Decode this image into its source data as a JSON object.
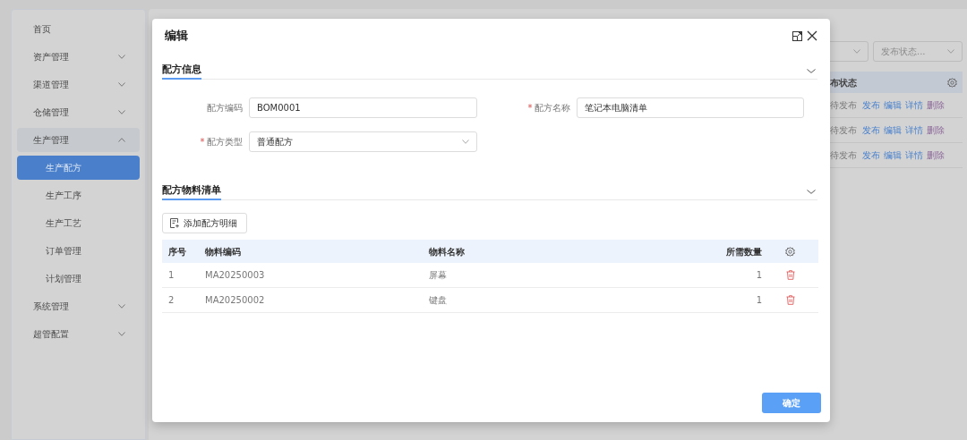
{
  "sidebar": {
    "items": [
      {
        "label": "首页",
        "kind": "link",
        "selected": false
      },
      {
        "label": "资产管理",
        "kind": "group",
        "selected": false,
        "expanded": false
      },
      {
        "label": "渠道管理",
        "kind": "group",
        "selected": false,
        "expanded": false
      },
      {
        "label": "仓储管理",
        "kind": "group",
        "selected": false,
        "expanded": false
      },
      {
        "label": "生产管理",
        "kind": "group",
        "selected": false,
        "expanded": true,
        "children": [
          {
            "label": "生产配方",
            "selected": true
          },
          {
            "label": "生产工序",
            "selected": false
          },
          {
            "label": "生产工艺",
            "selected": false
          },
          {
            "label": "订单管理",
            "selected": false
          },
          {
            "label": "计划管理",
            "selected": false
          }
        ]
      },
      {
        "label": "系统管理",
        "kind": "group",
        "selected": false,
        "expanded": false
      },
      {
        "label": "超管配置",
        "kind": "group",
        "selected": false,
        "expanded": false
      }
    ]
  },
  "page": {
    "filters": [
      {
        "kind": "select"
      },
      {
        "kind": "select",
        "placeholder": "发布状态..."
      }
    ],
    "table": {
      "columns": [
        "布状态"
      ],
      "rows": [
        {
          "status": "待发布",
          "actions": [
            {
              "label": "发布",
              "kind": "link"
            },
            {
              "label": "编辑",
              "kind": "link"
            },
            {
              "label": "详情",
              "kind": "link"
            },
            {
              "label": "删除",
              "kind": "danger"
            }
          ]
        },
        {
          "status": "待发布",
          "actions": [
            {
              "label": "发布",
              "kind": "link"
            },
            {
              "label": "编辑",
              "kind": "link"
            },
            {
              "label": "详情",
              "kind": "link"
            },
            {
              "label": "删除",
              "kind": "danger"
            }
          ]
        },
        {
          "status": "待发布",
          "actions": [
            {
              "label": "发布",
              "kind": "link"
            },
            {
              "label": "编辑",
              "kind": "link"
            },
            {
              "label": "详情",
              "kind": "link"
            },
            {
              "label": "删除",
              "kind": "danger"
            }
          ]
        }
      ]
    }
  },
  "dialog": {
    "title": "编辑",
    "sections": [
      {
        "title": "配方信息",
        "expanded": true,
        "fields": [
          {
            "label": "配方编码",
            "kind": "input",
            "value": "BOM0001"
          },
          {
            "label": "配方名称",
            "required_mark": "*",
            "kind": "input",
            "value": "笔记本电脑清单"
          },
          {
            "label": "配方类型",
            "required_mark": "*",
            "kind": "select",
            "value": "普通配方"
          }
        ]
      },
      {
        "title": "配方物料清单",
        "expanded": true,
        "add_button": "添加配方明细",
        "table": {
          "columns": [
            "序号",
            "物料编码",
            "物料名称",
            "所需数量"
          ],
          "rows": [
            {
              "no": "1",
              "code": "MA20250003",
              "name": "屏幕",
              "qty": "1"
            },
            {
              "no": "2",
              "code": "MA20250002",
              "name": "键盘",
              "qty": "1"
            }
          ]
        }
      }
    ],
    "confirm_button": "确定"
  }
}
